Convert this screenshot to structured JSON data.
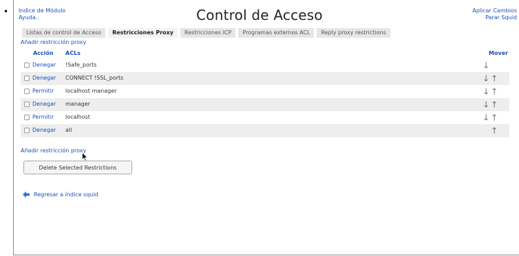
{
  "header": {
    "bullet": "•",
    "left_links": [
      "Indice de Módulo",
      "Ayuda.."
    ],
    "title": "Control de Acceso",
    "right_links": [
      "Aplicar Cambios",
      "Parar Squid"
    ]
  },
  "tabs": [
    {
      "label": "Listas de control de Acceso",
      "active": false
    },
    {
      "label": "Restricciones Proxy",
      "active": true
    },
    {
      "label": "Restricciones ICP",
      "active": false
    },
    {
      "label": "Programas externos ACL",
      "active": false
    },
    {
      "label": "Reply proxy restrictions",
      "active": false
    }
  ],
  "add_restriction_label": "Añadir restricción proxy",
  "table": {
    "columns": {
      "action": "Acción",
      "acls": "ACLs",
      "move": "Mover"
    },
    "rows": [
      {
        "action": "Denegar",
        "acls": "!Safe_ports",
        "down": true,
        "up": false
      },
      {
        "action": "Denegar",
        "acls": "CONNECT !SSL_ports",
        "down": true,
        "up": true
      },
      {
        "action": "Permitir",
        "acls": "localhost manager",
        "down": true,
        "up": true
      },
      {
        "action": "Denegar",
        "acls": "manager",
        "down": true,
        "up": true
      },
      {
        "action": "Permitir",
        "acls": "localhost",
        "down": true,
        "up": true
      },
      {
        "action": "Denegar",
        "acls": "all",
        "down": false,
        "up": true
      }
    ]
  },
  "delete_button_label": "Delete Selected Restrictions",
  "back_link_label": "Regresar a índice squid",
  "colors": {
    "link": "#1a4fb5",
    "alt_row": "#eeeeee",
    "back_arrow": "#2a6fd6"
  },
  "icons": {
    "down": "arrow-down-icon",
    "up": "arrow-up-icon",
    "back": "arrow-left-icon"
  }
}
